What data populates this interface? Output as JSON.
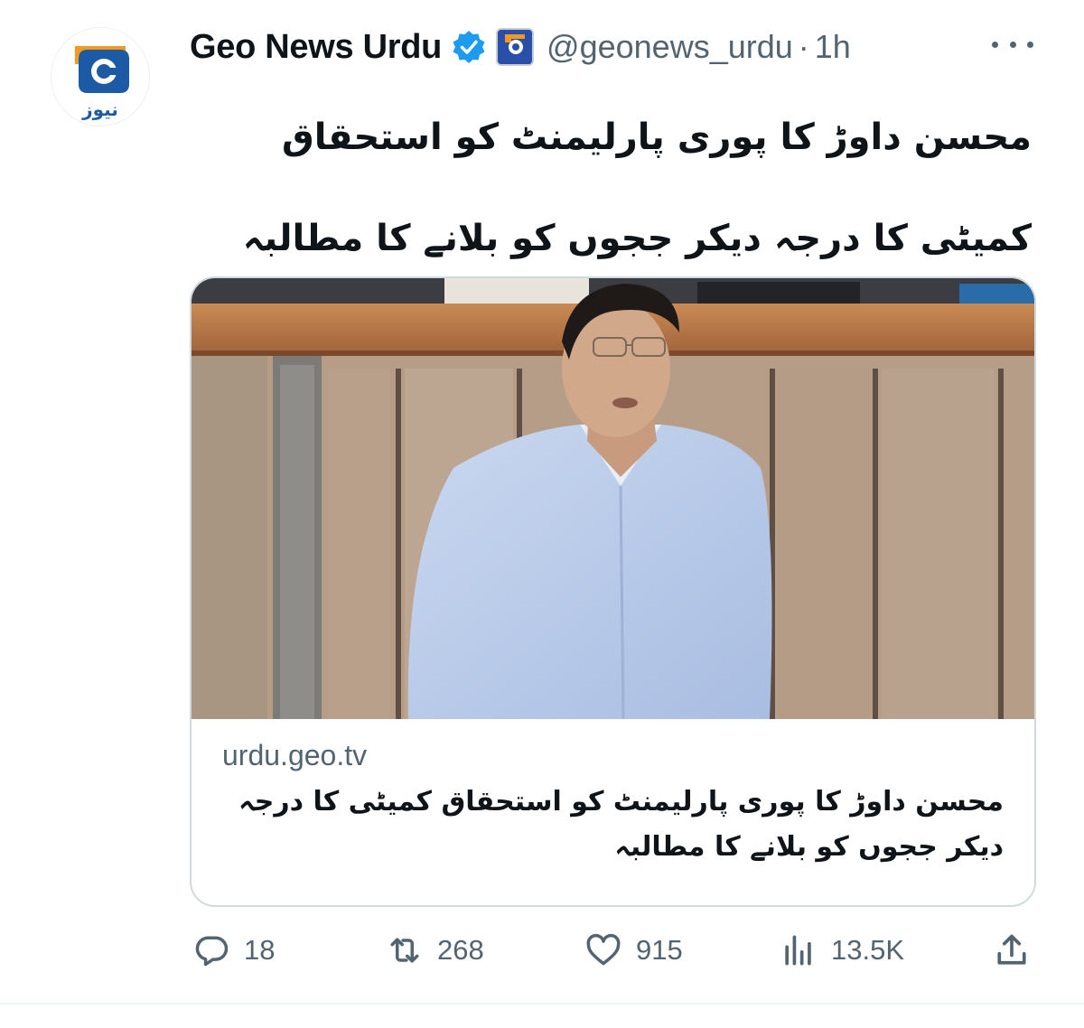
{
  "account": {
    "display_name": "Geo News Urdu",
    "handle": "@geonews_urdu",
    "separator": "·",
    "time": "1h",
    "avatar_logo_text": "نیوز",
    "affiliate_badge_text": "جیو"
  },
  "tweet": {
    "text": "محسن داوڑ کا پوری پارلیمنٹ کو استحقاق کمیٹی کا درجہ دیکر ججوں کو بلانے کا مطالبہ"
  },
  "card": {
    "domain": "urdu.geo.tv",
    "title": "محسن داوڑ کا پوری پارلیمنٹ کو استحقاق کمیٹی کا درجہ دیکر ججوں کو بلانے کا مطالبہ"
  },
  "actions": {
    "replies": "18",
    "retweets": "268",
    "likes": "915",
    "views": "13.5K"
  },
  "icons": {
    "verified": "verified-badge-icon",
    "more": "more-options-icon",
    "reply": "reply-icon",
    "retweet": "retweet-icon",
    "like": "heart-icon",
    "views": "views-chart-icon",
    "share": "share-icon"
  },
  "colors": {
    "verified_blue": "#1d9bf0",
    "secondary_text": "#536471",
    "geo_orange": "#f29a1f",
    "geo_blue": "#1c5aa6"
  }
}
